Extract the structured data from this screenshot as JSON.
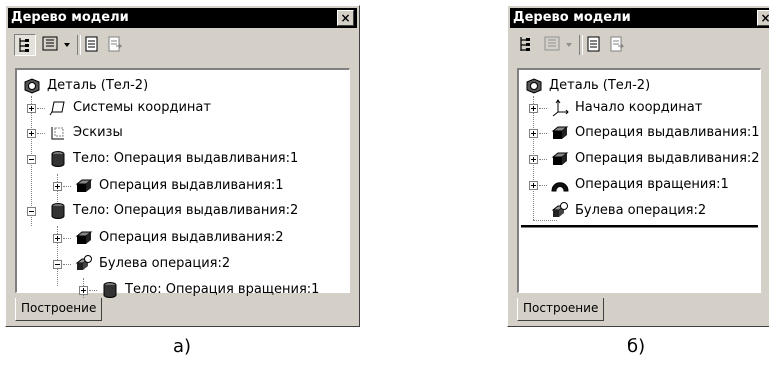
{
  "panel_a": {
    "title": "Дерево модели",
    "close": "×",
    "tab": "Построение",
    "tree": {
      "root": "Деталь (Тел-2)",
      "coords": "Системы координат",
      "sketches": "Эскизы",
      "body1": "Тело:  Операция выдавливания:1",
      "body1_op": "Операция выдавливания:1",
      "body2": "Тело:  Операция выдавливания:2",
      "body2_op": "Операция выдавливания:2",
      "bool": "Булева операция:2",
      "bool_body": "Тело:  Операция вращения:1"
    },
    "caption": "а)"
  },
  "panel_b": {
    "title": "Дерево модели",
    "close": "×",
    "tab": "Построение",
    "tree": {
      "root": "Деталь (Тел-2)",
      "origin": "Начало координат",
      "extrude1": "Операция выдавливания:1",
      "extrude2": "Операция выдавливания:2",
      "revolve": "Операция вращения:1",
      "bool": "Булева операция:2"
    },
    "caption": "б)"
  },
  "icons": {
    "part": "part-icon",
    "coord_system": "coordinate-system-icon",
    "sketch": "sketch-icon",
    "body": "body-icon",
    "extrusion": "extrusion-icon",
    "boolean": "boolean-operation-icon",
    "origin": "origin-icon",
    "revolution": "revolution-icon"
  }
}
